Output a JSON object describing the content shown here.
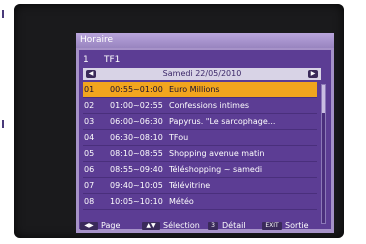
{
  "header": {
    "title": "Horaire"
  },
  "channel": {
    "number": "1",
    "name": "TF1"
  },
  "date_bar": {
    "date": "Samedi 22/05/2010",
    "prev_icon": "chevron-left-icon",
    "next_icon": "chevron-right-icon"
  },
  "programs": [
    {
      "idx": "01",
      "time": "00:55~01:00",
      "title": "Euro Millions",
      "selected": true
    },
    {
      "idx": "02",
      "time": "01:00~02:55",
      "title": "Confessions intimes"
    },
    {
      "idx": "03",
      "time": "06:00~06:30",
      "title": "Papyrus. \"Le sarcophage..."
    },
    {
      "idx": "04",
      "time": "06:30~08:10",
      "title": "TFou"
    },
    {
      "idx": "05",
      "time": "08:10~08:55",
      "title": "Shopping avenue matin"
    },
    {
      "idx": "06",
      "time": "08:55~09:40",
      "title": "Téléshopping ~ samedi"
    },
    {
      "idx": "07",
      "time": "09:40~10:05",
      "title": "Télévitrine"
    },
    {
      "idx": "08",
      "time": "10:05~10:10",
      "title": "Météo"
    }
  ],
  "footer": {
    "page_key": "◀▶",
    "page_label": "Page",
    "select_key": "▲▼",
    "select_label": "Sélection",
    "detail_key": "3",
    "detail_label": "Détail",
    "exit_key": "EXIT",
    "exit_label": "Sortie"
  },
  "colors": {
    "panel_bg": "#5c3d94",
    "highlight": "#f2a51e",
    "frame": "#a692c8"
  }
}
